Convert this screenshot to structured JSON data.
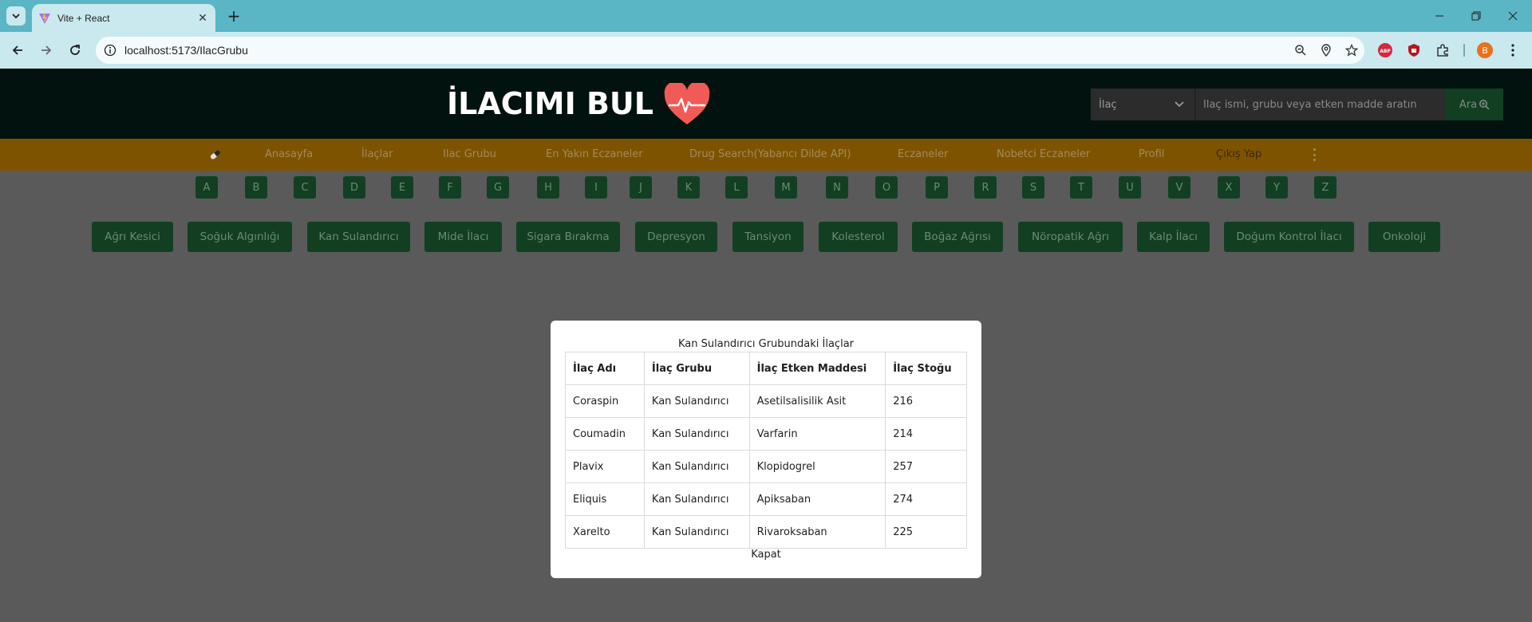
{
  "browser": {
    "tab_title": "Vite + React",
    "url": "localhost:5173/IlacGrubu",
    "profile_initial": "B",
    "extensions": [
      "abp-icon",
      "ublock-icon",
      "puzzle-icon"
    ],
    "accent": "#5ab6c4"
  },
  "header": {
    "logo_text": "İLACIMI BUL",
    "search_type": "İlaç",
    "search_placeholder": "İlaç ismi, grubu veya etken madde aratın",
    "search_button": "Ara"
  },
  "nav": {
    "items": [
      "Anasayfa",
      "İlaçlar",
      "Ilac Grubu",
      "En Yakın Eczaneler",
      "Drug Search(Yabancı Dilde API)",
      "Eczaneler",
      "Nobetci Eczaneler",
      "Profil",
      "Çıkış Yap"
    ]
  },
  "letters": [
    "A",
    "B",
    "C",
    "D",
    "E",
    "F",
    "G",
    "H",
    "I",
    "J",
    "K",
    "L",
    "M",
    "N",
    "O",
    "P",
    "R",
    "S",
    "T",
    "U",
    "V",
    "X",
    "Y",
    "Z"
  ],
  "groups": [
    "Ağrı Kesici",
    "Soğuk Algınlığı",
    "Kan Sulandırıcı",
    "Mide İlacı",
    "Sigara Bırakma",
    "Depresyon",
    "Tansiyon",
    "Kolesterol",
    "Boğaz Ağrısı",
    "Nöropatik Ağrı",
    "Kalp İlacı",
    "Doğum Kontrol İlacı",
    "Onkoloji"
  ],
  "modal": {
    "title": "Kan Sulandırıcı Grubundaki İlaçlar",
    "headers": [
      "İlaç Adı",
      "İlaç Grubu",
      "İlaç Etken Maddesi",
      "İlaç Stoğu"
    ],
    "rows": [
      [
        "Coraspin",
        "Kan Sulandırıcı",
        "Asetilsalisilik Asit",
        "216"
      ],
      [
        "Coumadin",
        "Kan Sulandırıcı",
        "Varfarin",
        "214"
      ],
      [
        "Plavix",
        "Kan Sulandırıcı",
        "Klopidogrel",
        "257"
      ],
      [
        "Eliquis",
        "Kan Sulandırıcı",
        "Apiksaban",
        "274"
      ],
      [
        "Xarelto",
        "Kan Sulandırıcı",
        "Rivaroksaban",
        "225"
      ]
    ],
    "close_label": "Kapat"
  }
}
